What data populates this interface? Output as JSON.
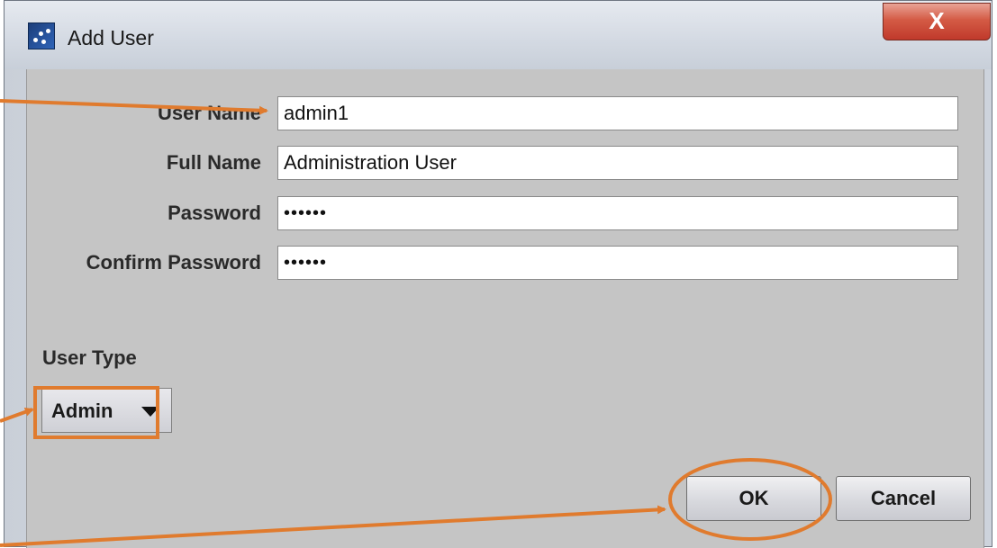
{
  "window": {
    "title": "Add User",
    "close_glyph": "X",
    "app_icon": "app-icon",
    "colors": {
      "close_button": "#c0392b",
      "client_bg": "#c5c5c5",
      "annotation": "#e07b2e"
    }
  },
  "form": {
    "user_name": {
      "label": "User Name",
      "value": "admin1"
    },
    "full_name": {
      "label": "Full Name",
      "value": "Administration User"
    },
    "password": {
      "label": "Password",
      "value": "••••••"
    },
    "confirm_password": {
      "label": "Confirm Password",
      "value": "••••••"
    }
  },
  "user_type": {
    "label": "User Type",
    "selected": "Admin",
    "icon": "dropdown-arrow-icon"
  },
  "buttons": {
    "ok": "OK",
    "cancel": "Cancel"
  }
}
